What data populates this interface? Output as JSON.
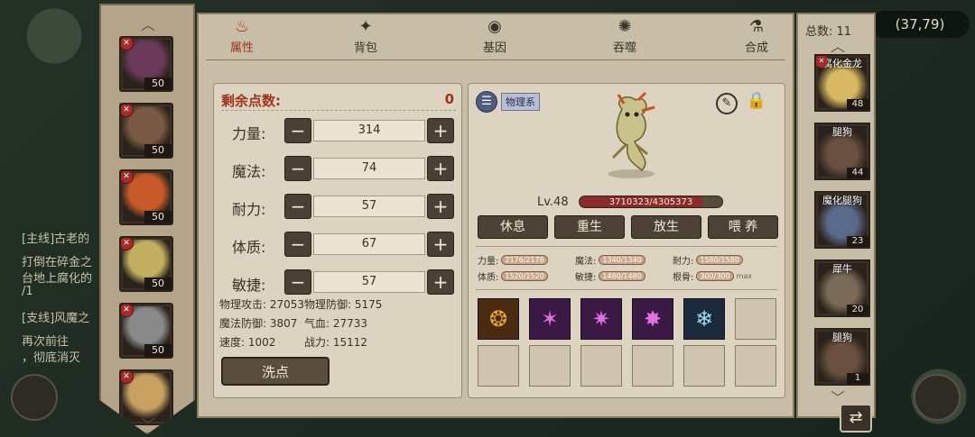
{
  "world": {
    "coord": "(37,79)",
    "quest_lines": [
      {
        "text": "[主线]古老的",
        "hl": false
      },
      {
        "text": "打倒在碎金之",
        "hl": false
      },
      {
        "text": "台地上腐化的",
        "hl": false
      },
      {
        "text": "/1",
        "hl": false
      },
      {
        "text": "[支线]风魔之",
        "hl": false
      },
      {
        "text": "再次前往",
        "hl": false
      },
      {
        "text": "，彻底消灭",
        "hl": false
      }
    ]
  },
  "heroes": [
    {
      "level": "50",
      "color": "#6b3a5a"
    },
    {
      "level": "50",
      "color": "#7a5a44"
    },
    {
      "level": "50",
      "color": "#c85a2a"
    },
    {
      "level": "50",
      "color": "#c2b060"
    },
    {
      "level": "50",
      "color": "#8a8a8a"
    },
    {
      "level": "",
      "color": "#c8a060"
    }
  ],
  "tabs": [
    {
      "label": "属性",
      "icon": "flame-icon",
      "glyph": "♨",
      "active": true
    },
    {
      "label": "背包",
      "icon": "bag-icon",
      "glyph": "✦",
      "active": false
    },
    {
      "label": "基因",
      "icon": "gene-eye-icon",
      "glyph": "◉",
      "active": false
    },
    {
      "label": "吞噬",
      "icon": "devour-icon",
      "glyph": "✺",
      "active": false
    },
    {
      "label": "合成",
      "icon": "synthesis-icon",
      "glyph": "⚗",
      "active": false
    }
  ],
  "attributes": {
    "remain_label": "剩余点数:",
    "remain_value": "0",
    "stats": [
      {
        "label": "力量:",
        "value": "314"
      },
      {
        "label": "魔法:",
        "value": "74"
      },
      {
        "label": "耐力:",
        "value": "57"
      },
      {
        "label": "体质:",
        "value": "67"
      },
      {
        "label": "敏捷:",
        "value": "57"
      }
    ],
    "derived": [
      [
        "物理攻击: 27053",
        "物理防御: 5175"
      ],
      [
        "魔法防御: 3807",
        "气血: 27733"
      ],
      [
        "速度: 1002",
        "战力: 15112"
      ]
    ],
    "minus": "−",
    "plus": "+",
    "wash_label": "洗点"
  },
  "pet": {
    "type_label": "物理系",
    "level": "Lv.48",
    "hp_text": "3710323/4305373",
    "hp_fraction": 0.862,
    "actions": [
      "休息",
      "重生",
      "放生",
      "喂 养"
    ],
    "stats": [
      {
        "label": "力量:",
        "value": "2176/2176"
      },
      {
        "label": "魔法:",
        "value": "1340/1340"
      },
      {
        "label": "耐力:",
        "value": "1580/1580"
      },
      {
        "label": "体质:",
        "value": "1520/1520"
      },
      {
        "label": "敏捷:",
        "value": "1480/1480"
      },
      {
        "label": "根骨:",
        "value": "300/300"
      }
    ],
    "max_label": "max",
    "skills": [
      {
        "name": "claw-skill-icon",
        "glyph": "❂",
        "color": "#e8a030",
        "bg": "#4a2a10"
      },
      {
        "name": "slash-skill-icon",
        "glyph": "✶",
        "color": "#e070e0",
        "bg": "#3a1a44"
      },
      {
        "name": "burst-skill-icon",
        "glyph": "✷",
        "color": "#e070e0",
        "bg": "#3a1a44"
      },
      {
        "name": "strike-skill-icon",
        "glyph": "✸",
        "color": "#e070e0",
        "bg": "#3a1a44"
      },
      {
        "name": "ice-skill-icon",
        "glyph": "❄",
        "color": "#a0d8f0",
        "bg": "#1a2a3a"
      },
      null,
      null,
      null,
      null,
      null,
      null,
      null
    ]
  },
  "pet_list": {
    "total": "总数: 11",
    "items": [
      {
        "name": "腐化金龙",
        "level": "48",
        "color": "#d8b860"
      },
      {
        "name": "腿狗",
        "level": "44",
        "color": "#6a5040"
      },
      {
        "name": "魔化腿狗",
        "level": "23",
        "color": "#5a6a8a"
      },
      {
        "name": "犀牛",
        "level": "20",
        "color": "#7a6a58"
      },
      {
        "name": "腿狗",
        "level": "1",
        "color": "#6a5040"
      }
    ]
  },
  "close_glyph": "⇄"
}
